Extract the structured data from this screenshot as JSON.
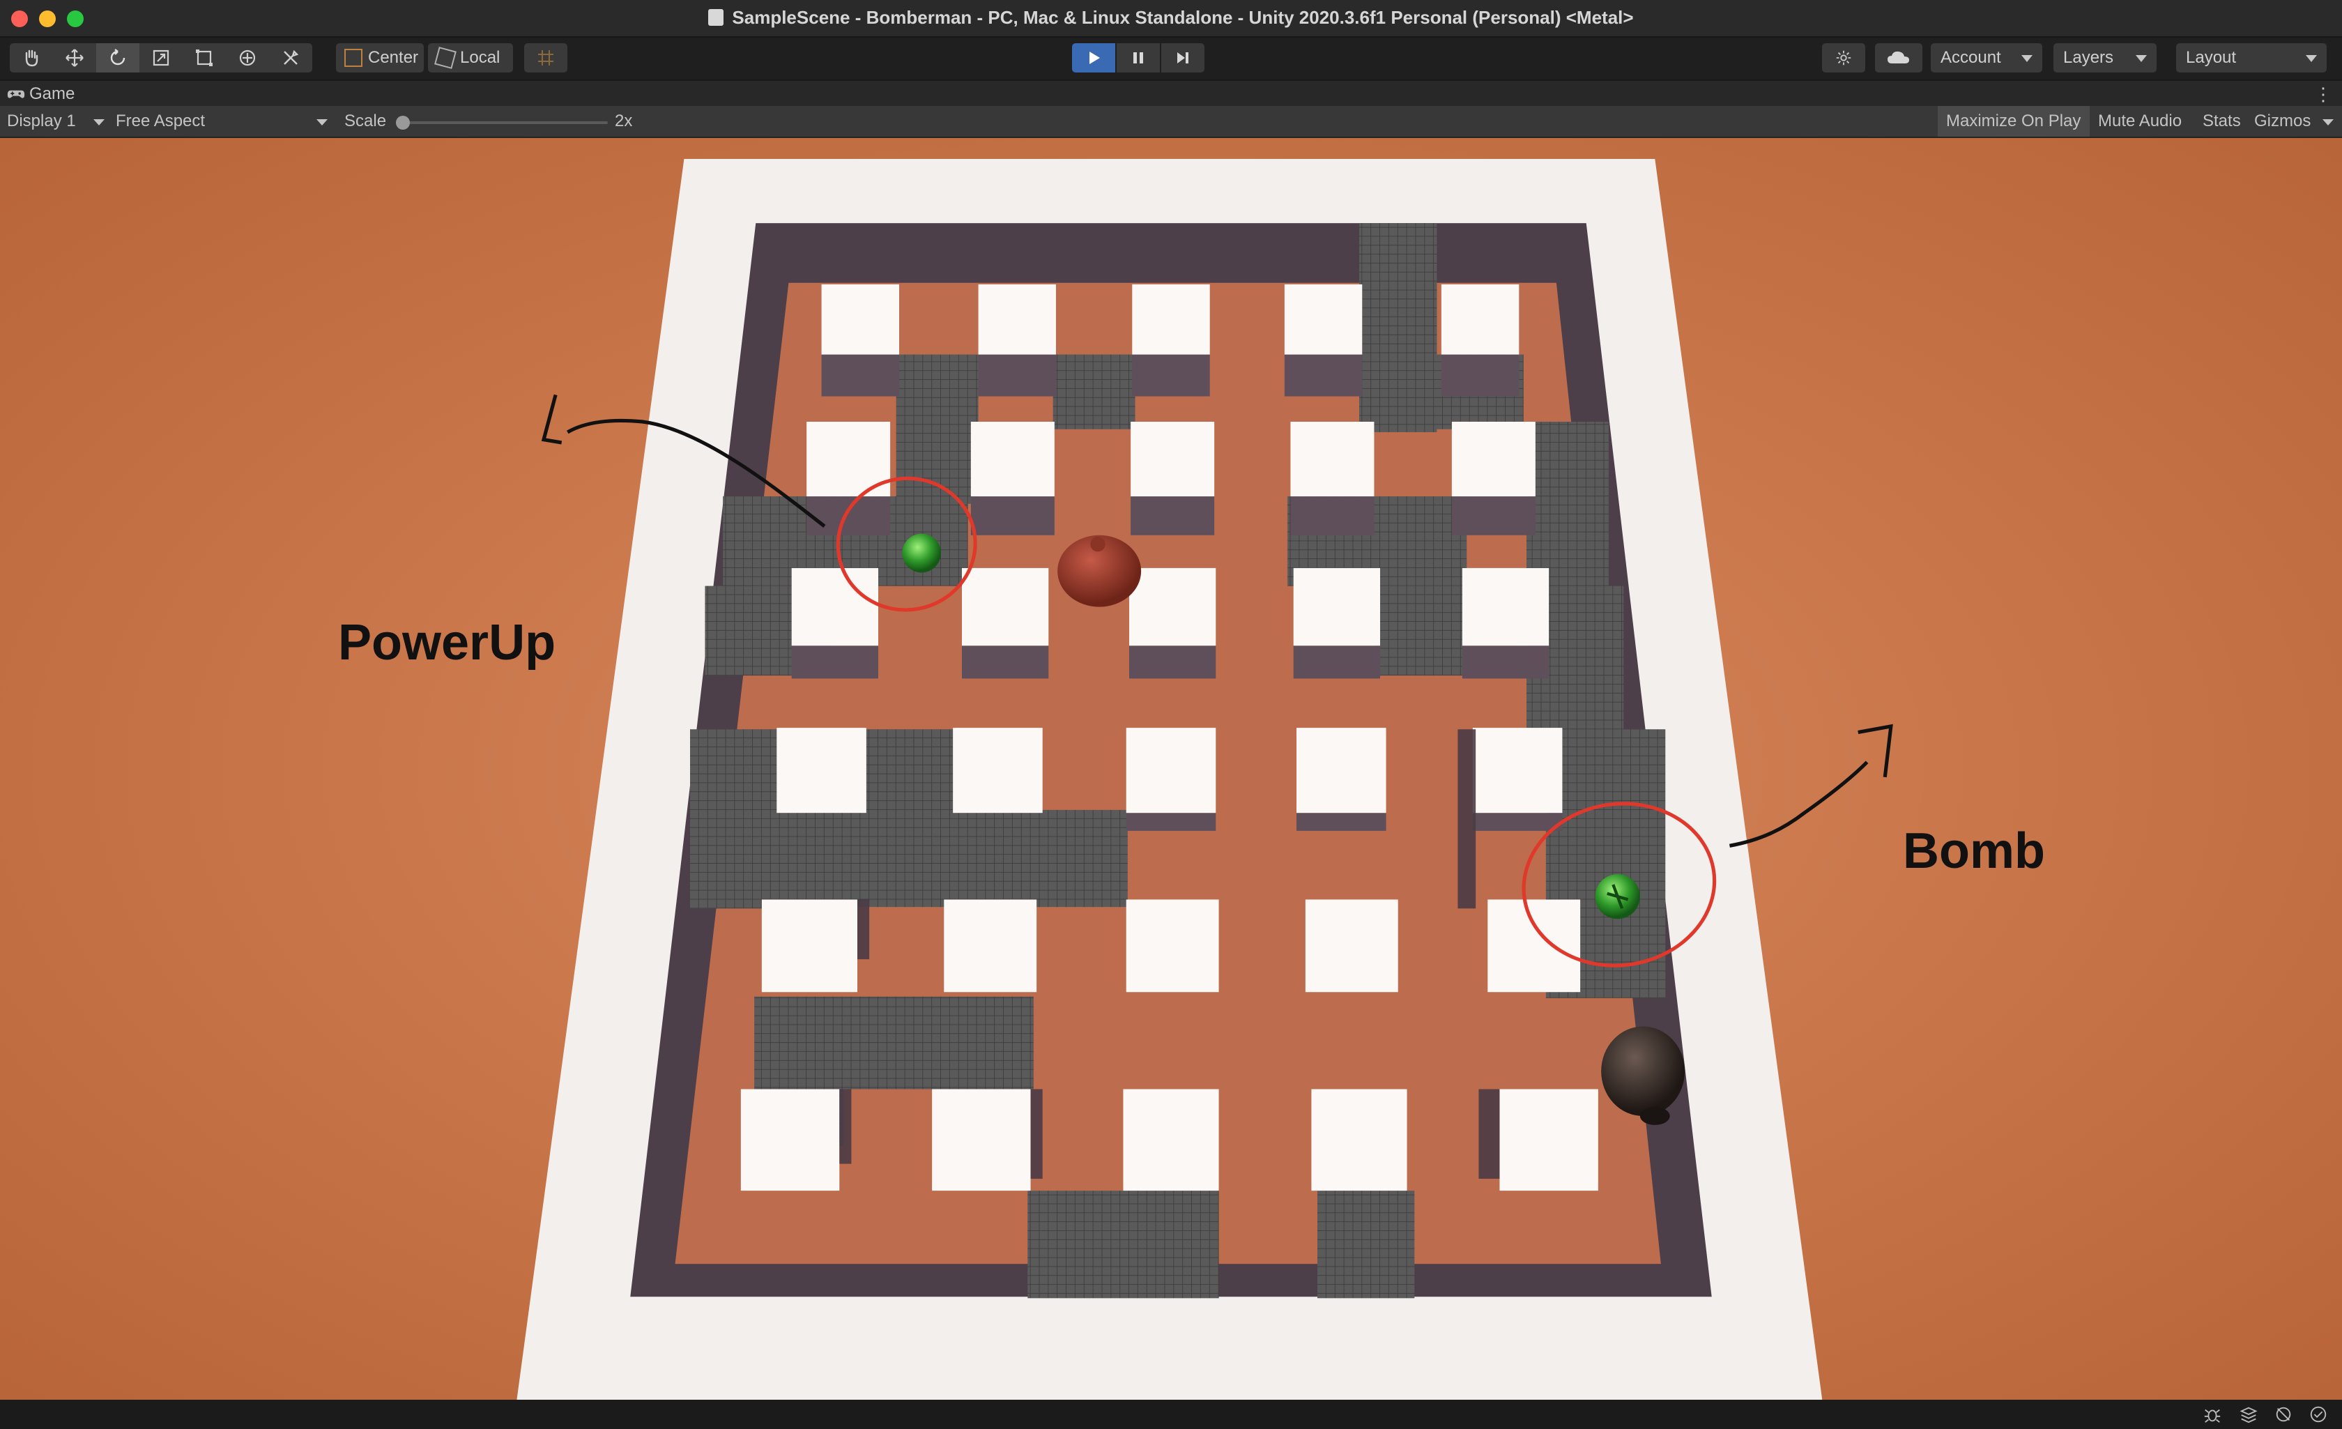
{
  "window": {
    "title": "SampleScene - Bomberman - PC, Mac & Linux Standalone - Unity 2020.3.6f1 Personal (Personal) <Metal>",
    "traffic_colors": [
      "#fe5f57",
      "#febc2e",
      "#28c840"
    ]
  },
  "toolbar": {
    "tools": [
      "hand-tool",
      "move-tool",
      "rotate-tool",
      "scale-tool",
      "rect-tool",
      "transform-tool",
      "custom-tool"
    ],
    "pivot_label": "Center",
    "space_label": "Local",
    "account_label": "Account",
    "layers_label": "Layers",
    "layout_label": "Layout",
    "play_active": true
  },
  "tab": {
    "label": "Game"
  },
  "gamebar": {
    "display": "Display 1",
    "aspect": "Free Aspect",
    "scale_label": "Scale",
    "scale_value": "2x",
    "maximize": "Maximize On Play",
    "mute": "Mute Audio",
    "stats": "Stats",
    "gizmos": "Gizmos"
  },
  "annotations": {
    "powerup": "PowerUp",
    "bomb": "Bomb"
  },
  "colors": {
    "ground": "#c8734a",
    "border": "#f4f0ee",
    "wall": "#5f4e5a",
    "block_top": "#faf6f4",
    "block_side": "#6b5b66",
    "grid": "#555555",
    "marker": "#e0392b",
    "powerup": "#3aa53a",
    "bomb": "#2e8f3e"
  }
}
